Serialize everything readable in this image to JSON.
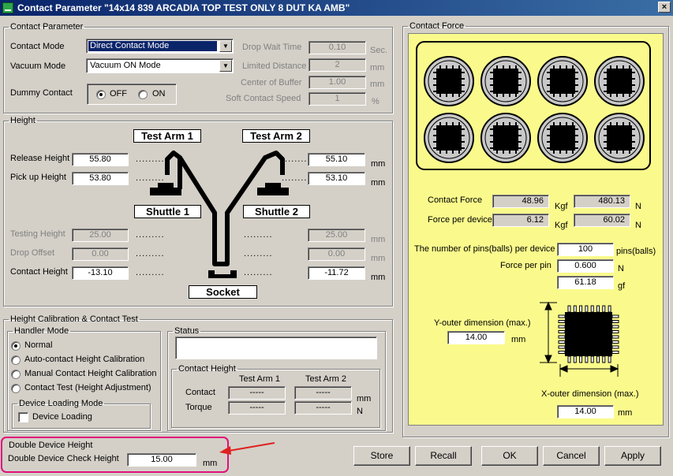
{
  "window": {
    "title": "Contact Parameter \"14x14 839 ARCADIA TOP TEST ONLY 8 DUT KA AMB\"",
    "close_glyph": "×"
  },
  "contact_parameter": {
    "legend": "Contact Parameter",
    "contact_mode_label": "Contact Mode",
    "contact_mode_value": "Direct Contact Mode",
    "vacuum_mode_label": "Vacuum Mode",
    "vacuum_mode_value": "Vacuum ON Mode",
    "dummy_contact_label": "Dummy Contact",
    "off_label": "OFF",
    "on_label": "ON",
    "drop_wait_time_label": "Drop Wait Time",
    "drop_wait_time_value": "0.10",
    "drop_wait_time_unit": "Sec.",
    "limited_distance_label": "Limited Distance",
    "limited_distance_value": "2",
    "limited_distance_unit": "mm",
    "center_of_buffer_label": "Center of Buffer",
    "center_of_buffer_value": "1.00",
    "center_of_buffer_unit": "mm",
    "soft_contact_speed_label": "Soft Contact Speed",
    "soft_contact_speed_value": "1",
    "soft_contact_speed_unit": "%"
  },
  "height": {
    "legend": "Height",
    "test_arm_1": "Test Arm 1",
    "test_arm_2": "Test Arm 2",
    "shuttle_1": "Shuttle 1",
    "shuttle_2": "Shuttle 2",
    "socket": "Socket",
    "release_height_label": "Release Height",
    "release_height_1": "55.80",
    "release_height_2": "55.10",
    "pickup_height_label": "Pick up  Height",
    "pickup_height_1": "53.80",
    "pickup_height_2": "53.10",
    "testing_height_label": "Testing Height",
    "testing_height_1": "25.00",
    "testing_height_2": "25.00",
    "drop_offset_label": "Drop Offset",
    "drop_offset_1": "0.00",
    "drop_offset_2": "0.00",
    "contact_height_label": "Contact Height",
    "contact_height_1": "-13.10",
    "contact_height_2": "-11.72",
    "unit": "mm",
    "dots": "........."
  },
  "calibration": {
    "legend": "Height Calibration & Contact Test",
    "handler_mode_legend": "Handler Mode",
    "modes": [
      {
        "label": "Normal",
        "checked": true
      },
      {
        "label": "Auto-contact Height Calibration",
        "checked": false
      },
      {
        "label": "Manual Contact Height Calibration",
        "checked": false
      },
      {
        "label": "Contact Test (Height Adjustment)",
        "checked": false
      }
    ],
    "device_loading_legend": "Device Loading Mode",
    "device_loading_label": "Device Loading",
    "status_legend": "Status",
    "status_value": "",
    "contact_height_legend": "Contact Height",
    "col_arm1": "Test Arm 1",
    "col_arm2": "Test Arm 2",
    "contact_label": "Contact",
    "torque_label": "Torque",
    "contact_arm1": "-----",
    "contact_arm2": "-----",
    "torque_arm1": "-----",
    "torque_arm2": "-----",
    "contact_unit": "mm",
    "torque_unit": "N"
  },
  "double_device": {
    "legend": "Double Device Height",
    "check_height_label": "Double Device Check Height",
    "check_height_value": "15.00",
    "unit": "mm"
  },
  "contact_force": {
    "legend": "Contact Force",
    "device_count": 8,
    "contact_force_label": "Contact Force",
    "contact_force_kgf": "48.96",
    "contact_force_n": "480.13",
    "force_per_device_label": "Force per device",
    "force_per_device_kgf": "6.12",
    "force_per_device_n": "60.02",
    "kgf_unit": "Kgf",
    "n_unit": "N",
    "pins_label": "The number of pins(balls) per device",
    "pins_value": "100",
    "pins_unit": "pins(balls)",
    "force_per_pin_label": "Force per pin",
    "force_per_pin_n": "0.600",
    "force_per_pin_n_unit": "N",
    "force_per_pin_gf": "61.18",
    "force_per_pin_gf_unit": "gf",
    "y_outer_label": "Y-outer dimension (max.)",
    "y_outer_value": "14.00",
    "y_outer_unit": "mm",
    "x_outer_label": "X-outer dimension (max.)",
    "x_outer_value": "14.00",
    "x_outer_unit": "mm"
  },
  "buttons": {
    "store": "Store",
    "recall": "Recall",
    "ok": "OK",
    "cancel": "Cancel",
    "apply": "Apply"
  },
  "colors": {
    "titlebar": "#0a246a",
    "panel_yellow": "#fafa8c",
    "highlight_outline": "#e0107a",
    "arrow_red": "#e02020"
  }
}
